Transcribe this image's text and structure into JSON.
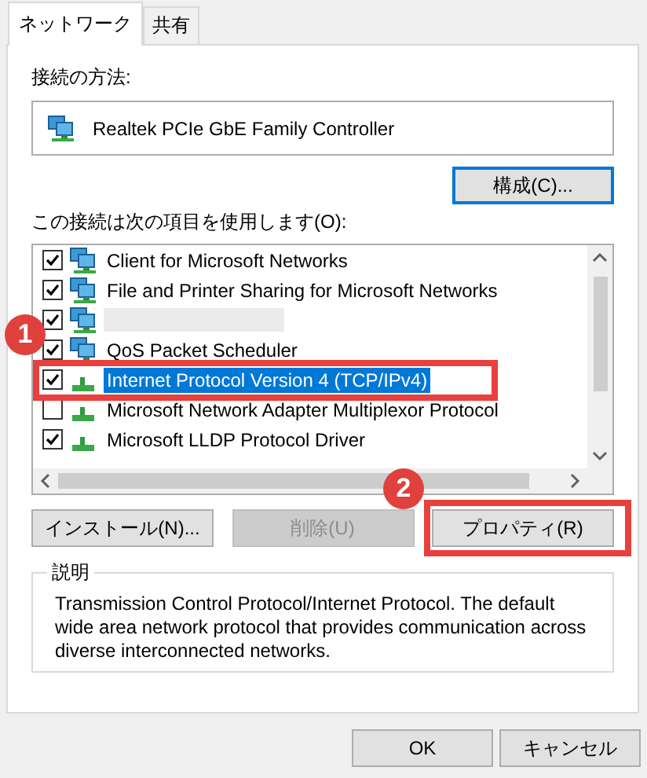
{
  "tabs": [
    {
      "label": "ネットワーク",
      "selected": true
    },
    {
      "label": "共有",
      "selected": false
    }
  ],
  "connect_using": {
    "label": "接続の方法:",
    "adapter": "Realtek PCIe GbE Family Controller",
    "configure_button": "構成(C)..."
  },
  "items_label": "この接続は次の項目を使用します(O):",
  "items": [
    {
      "kind": "service",
      "label": "Client for Microsoft Networks",
      "checked": true,
      "selected": false
    },
    {
      "kind": "service",
      "label": "File and Printer Sharing for Microsoft Networks",
      "checked": true,
      "selected": false
    },
    {
      "kind": "blurred",
      "checked": true,
      "selected": false
    },
    {
      "kind": "service",
      "label": "QoS Packet Scheduler",
      "checked": true,
      "selected": false
    },
    {
      "kind": "protocol",
      "label": "Internet Protocol Version 4 (TCP/IPv4)",
      "checked": true,
      "selected": true
    },
    {
      "kind": "protocol",
      "label": "Microsoft Network Adapter Multiplexor Protocol",
      "checked": false,
      "selected": false
    },
    {
      "kind": "protocol",
      "label": "Microsoft LLDP Protocol Driver",
      "checked": true,
      "selected": false
    }
  ],
  "buttons": [
    {
      "label": "インストール(N)...",
      "disabled": false
    },
    {
      "label": "削除(U)",
      "disabled": true
    },
    {
      "label": "プロパティ(R)",
      "disabled": false
    }
  ],
  "description": {
    "title": "説明",
    "text": "Transmission Control Protocol/Internet Protocol. The default wide area network protocol that provides communication across diverse interconnected networks."
  },
  "annotations": [
    {
      "label": "1"
    },
    {
      "label": "2"
    }
  ],
  "dialog_buttons": [
    "OK",
    "キャンセル"
  ]
}
